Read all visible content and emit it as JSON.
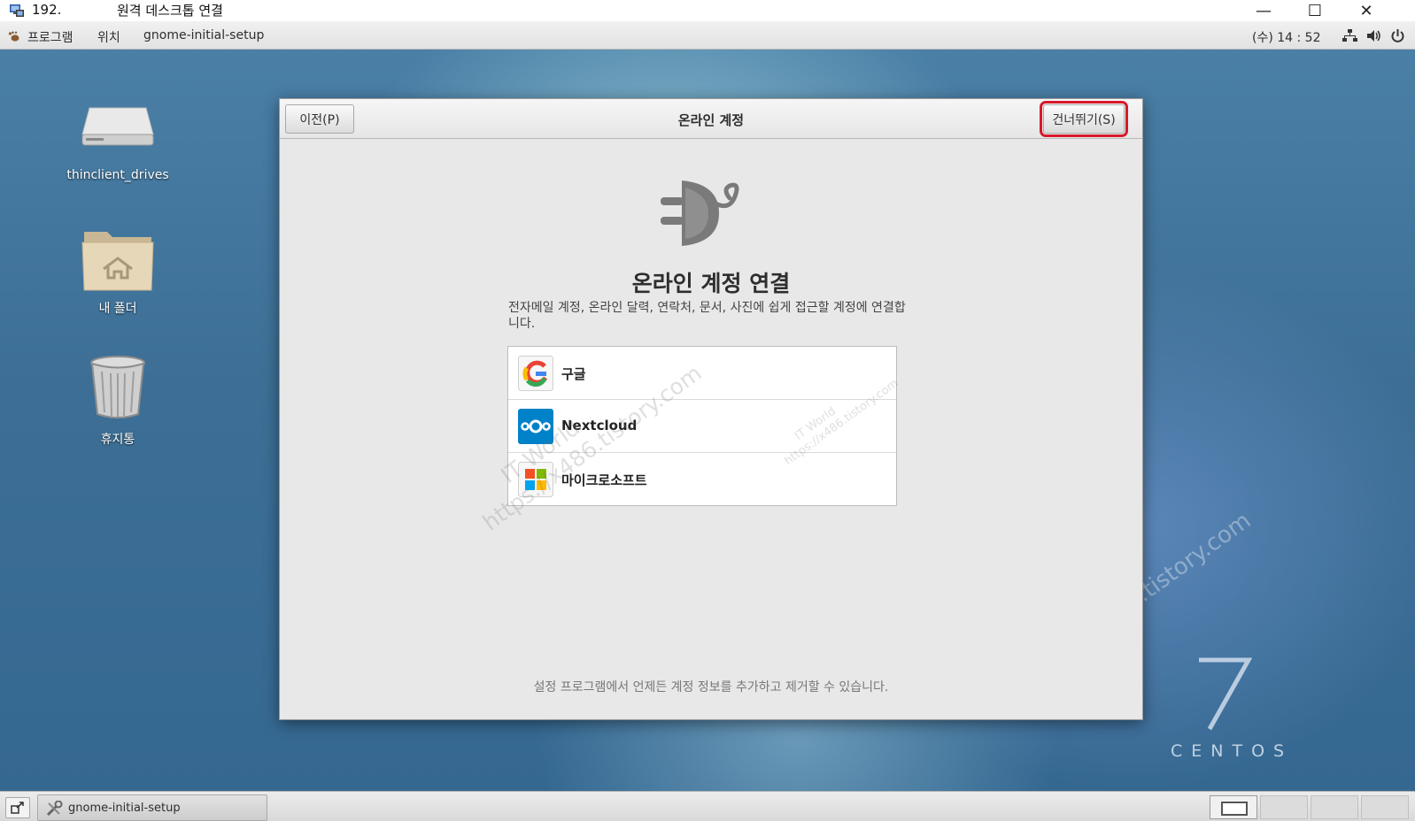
{
  "remote_window": {
    "host": "192.",
    "title": "원격 데스크톱 연결",
    "controls": {
      "minimize": "—",
      "maximize": "☐",
      "close": "✕"
    }
  },
  "top_panel": {
    "applications": "프로그램",
    "places": "위치",
    "active_app": "gnome-initial-setup",
    "clock": "(수) 14 : 52",
    "tray_icons": [
      "network-icon",
      "volume-icon",
      "power-icon"
    ]
  },
  "desktop": {
    "icons": [
      {
        "label": "thinclient_drives",
        "icon": "drive-icon"
      },
      {
        "label": "내 폴더",
        "icon": "home-folder-icon"
      },
      {
        "label": "휴지통",
        "icon": "trash-icon"
      }
    ],
    "branding": {
      "number": "7",
      "text": "CENTOS"
    },
    "watermark": {
      "line1": "IT World",
      "line2": "https://x486.tistory.com"
    }
  },
  "setup_window": {
    "prev_button": "이전(P)",
    "title": "온라인 계정",
    "skip_button": "건너뛰기(S)",
    "heading": "온라인 계정 연결",
    "description": "전자메일 계정, 온라인 달력, 연락처, 문서, 사진에 쉽게 접근할 계정에 연결합니다.",
    "accounts": [
      {
        "name": "구글",
        "icon": "google-icon"
      },
      {
        "name": "Nextcloud",
        "icon": "nextcloud-icon"
      },
      {
        "name": "마이크로소프트",
        "icon": "microsoft-icon"
      }
    ],
    "footer": "설정 프로그램에서 언제든 계정 정보를 추가하고 제거할 수 있습니다."
  },
  "bottom_panel": {
    "task": "gnome-initial-setup",
    "workspaces": 4,
    "active_workspace": 1
  },
  "colors": {
    "highlight": "#d7182a",
    "nextcloud": "#0082c9"
  }
}
